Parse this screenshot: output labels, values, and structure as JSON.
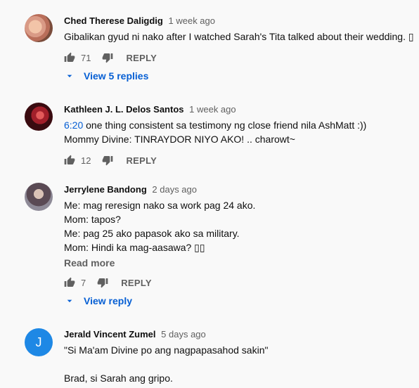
{
  "comments": [
    {
      "author": "Ched Therese Daligdig",
      "time": "1 week ago",
      "lines": [
        "Gibalikan gyud ni nako after I watched Sarah's Tita talked about their wedding. ▯"
      ],
      "likes": "71",
      "reply_label": "REPLY",
      "view_replies": "View 5 replies"
    },
    {
      "author": "Kathleen J. L. Delos Santos",
      "time": "1 week ago",
      "timestamp_link": "6:20",
      "lines": [
        " one thing consistent sa testimony ng close friend nila AshMatt :))",
        "Mommy Divine: TINRAYDOR NIYO AKO! .. charowt~"
      ],
      "likes": "12",
      "reply_label": "REPLY"
    },
    {
      "author": "Jerrylene Bandong",
      "time": "2 days ago",
      "lines": [
        "Me: mag reresign nako sa work pag 24 ako.",
        "Mom: tapos?",
        "Me: pag 25 ako papasok ako sa military.",
        "Mom: Hindi ka mag-aasawa? ▯▯"
      ],
      "read_more": "Read more",
      "likes": "7",
      "reply_label": "REPLY",
      "view_replies": "View reply"
    },
    {
      "author": "Jerald Vincent Zumel",
      "time": "5 days ago",
      "avatar_letter": "J",
      "lines": [
        "\"Si Ma'am Divine po ang nagpapasahod  sakin\"",
        "Brad, si Sarah ang gripo."
      ]
    }
  ],
  "icons": {
    "like": "thumb-up-icon",
    "dislike": "thumb-down-icon",
    "expand": "chevron-down-icon"
  },
  "colors": {
    "link": "#065fd4",
    "secondary_text": "#606060",
    "avatar_j": "#1e88e5"
  }
}
